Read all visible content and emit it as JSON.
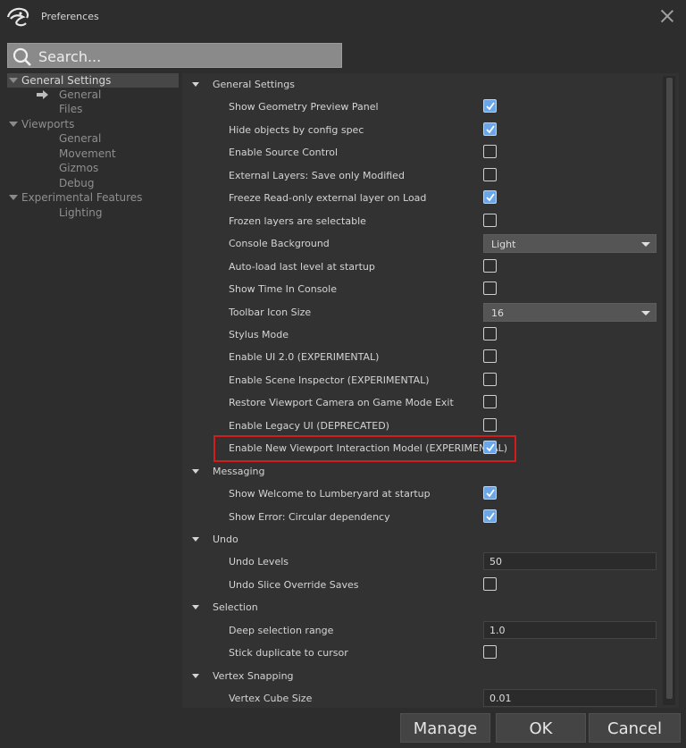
{
  "window": {
    "title": "Preferences"
  },
  "search": {
    "placeholder": "Search..."
  },
  "tree": [
    {
      "label": "General Settings",
      "level": 0,
      "expanded": true,
      "selected": true
    },
    {
      "label": "General",
      "level": 1,
      "current": true
    },
    {
      "label": "Files",
      "level": 1
    },
    {
      "label": "Viewports",
      "level": 0,
      "expanded": true
    },
    {
      "label": "General",
      "level": 1
    },
    {
      "label": "Movement",
      "level": 1
    },
    {
      "label": "Gizmos",
      "level": 1
    },
    {
      "label": "Debug",
      "level": 1
    },
    {
      "label": "Experimental Features",
      "level": 0,
      "expanded": true
    },
    {
      "label": "Lighting",
      "level": 1
    }
  ],
  "rows": [
    {
      "type": "section",
      "label": "General Settings"
    },
    {
      "type": "checkbox",
      "label": "Show Geometry Preview Panel",
      "checked": true
    },
    {
      "type": "checkbox",
      "label": "Hide objects by config spec",
      "checked": true
    },
    {
      "type": "checkbox",
      "label": "Enable Source Control",
      "checked": false
    },
    {
      "type": "checkbox",
      "label": "External Layers: Save only Modified",
      "checked": false
    },
    {
      "type": "checkbox",
      "label": "Freeze Read-only external layer on Load",
      "checked": true
    },
    {
      "type": "checkbox",
      "label": "Frozen layers are selectable",
      "checked": false
    },
    {
      "type": "dropdown",
      "label": "Console Background",
      "value": "Light"
    },
    {
      "type": "checkbox",
      "label": "Auto-load last level at startup",
      "checked": false
    },
    {
      "type": "checkbox",
      "label": "Show Time In Console",
      "checked": false
    },
    {
      "type": "dropdown",
      "label": "Toolbar Icon Size",
      "value": "16"
    },
    {
      "type": "checkbox",
      "label": "Stylus Mode",
      "checked": false
    },
    {
      "type": "checkbox",
      "label": "Enable UI 2.0 (EXPERIMENTAL)",
      "checked": false
    },
    {
      "type": "checkbox",
      "label": "Enable Scene Inspector (EXPERIMENTAL)",
      "checked": false
    },
    {
      "type": "checkbox",
      "label": "Restore Viewport Camera on Game Mode Exit",
      "checked": false
    },
    {
      "type": "checkbox",
      "label": "Enable Legacy UI (DEPRECATED)",
      "checked": false
    },
    {
      "type": "checkbox",
      "label": "Enable New Viewport Interaction Model (EXPERIMENTAL)",
      "checked": true
    },
    {
      "type": "section",
      "label": "Messaging"
    },
    {
      "type": "checkbox",
      "label": "Show Welcome to Lumberyard at startup",
      "checked": true
    },
    {
      "type": "checkbox",
      "label": "Show Error: Circular dependency",
      "checked": true
    },
    {
      "type": "section",
      "label": "Undo"
    },
    {
      "type": "number",
      "label": "Undo Levels",
      "value": "50"
    },
    {
      "type": "checkbox",
      "label": "Undo Slice Override Saves",
      "checked": false
    },
    {
      "type": "section",
      "label": "Selection"
    },
    {
      "type": "number",
      "label": "Deep selection range",
      "value": "1.0"
    },
    {
      "type": "checkbox",
      "label": "Stick duplicate to cursor",
      "checked": false
    },
    {
      "type": "section",
      "label": "Vertex Snapping"
    },
    {
      "type": "number",
      "label": "Vertex Cube Size",
      "value": "0.01"
    }
  ],
  "buttons": {
    "manage": "Manage",
    "ok": "OK",
    "cancel": "Cancel"
  },
  "colors": {
    "highlight": "#d41c1c",
    "checkbox_checked": "#6aa6e8",
    "background": "#2d2d2d"
  }
}
